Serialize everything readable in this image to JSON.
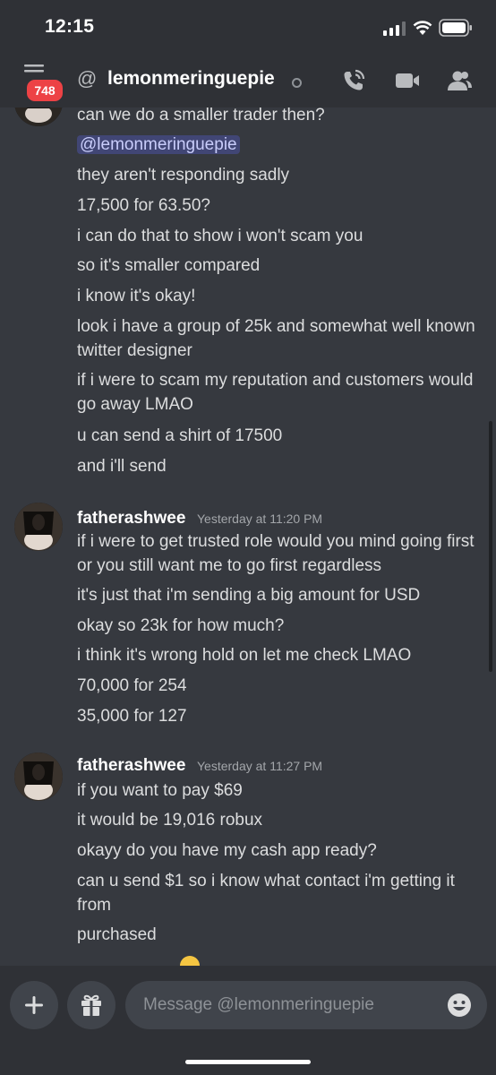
{
  "status": {
    "time": "12:15"
  },
  "header": {
    "unread_count": "748",
    "at_symbol": "@",
    "username": "lemonmeringuepie"
  },
  "messages": {
    "group1": {
      "lines": [
        "can we do a smaller trader then?",
        "@lemonmeringuepie",
        "they aren't responding sadly",
        "17,500 for 63.50?",
        "i can do that to show i won't scam you",
        "so it's smaller compared",
        "i know it's okay!",
        "look i have a group of 25k and somewhat well known twitter designer",
        "if i were to scam my reputation and customers would go away LMAO",
        "u can send a shirt of 17500",
        "and i'll send"
      ]
    },
    "group2": {
      "author": "fatherashwee",
      "timestamp": "Yesterday at 11:20 PM",
      "lines": [
        "if i were to get trusted role would you mind going first or you still want me to go first regardless",
        "it's just that i'm sending a big amount for USD",
        "okay so 23k for how much?",
        "i think it's wrong hold on let me check LMAO",
        "70,000 for 254",
        "35,000 for 127"
      ]
    },
    "group3": {
      "author": "fatherashwee",
      "timestamp": "Yesterday at 11:27 PM",
      "lines": [
        "if you want to pay $69",
        "it would be 19,016 robux",
        "okayy do you have my cash app ready?",
        "can u send $1 so i know what contact i'm getting it from",
        "purchased"
      ]
    }
  },
  "composer": {
    "placeholder": "Message @lemonmeringuepie"
  },
  "icons": {
    "menu": "hamburger-icon",
    "mention": "at-icon",
    "call": "phone-call-icon",
    "video": "video-camera-icon",
    "members": "members-icon",
    "add": "plus-icon",
    "gift": "gift-icon",
    "emoji": "emoji-icon"
  },
  "colors": {
    "background": "#36393f",
    "header": "#2f3136",
    "badge": "#ed4245",
    "mention_bg": "#414675"
  }
}
